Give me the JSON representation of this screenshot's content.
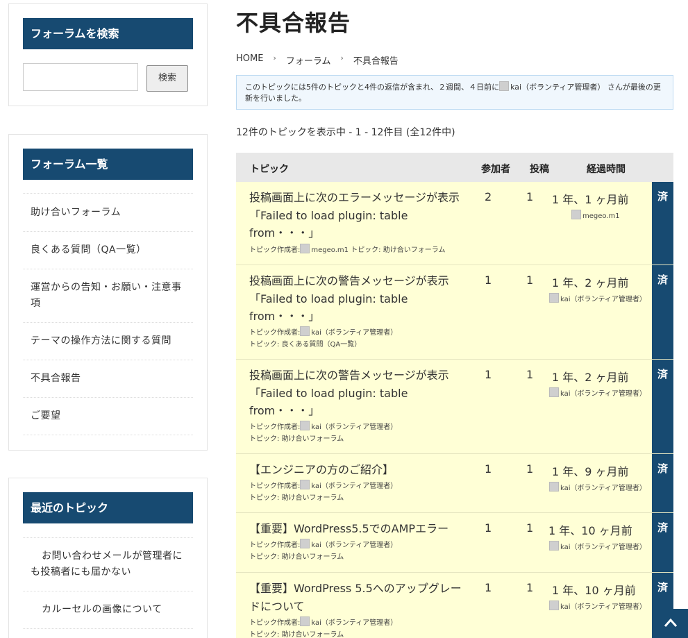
{
  "sidebar": {
    "search": {
      "title": "フォーラムを検索",
      "button": "検索",
      "value": ""
    },
    "forums": {
      "title": "フォーラム一覧",
      "items": [
        {
          "label": "助け合いフォーラム"
        },
        {
          "label": "良くある質問（QA一覧）"
        },
        {
          "label": "運営からの告知・お願い・注意事項"
        },
        {
          "label": "テーマの操作方法に関する質問"
        },
        {
          "label": "不具合報告"
        },
        {
          "label": "ご要望"
        }
      ]
    },
    "recent": {
      "title": "最近のトピック",
      "items": [
        {
          "label": "お問い合わせメールが管理者にも投稿者にも届かない"
        },
        {
          "label": "カルーセルの画像について"
        }
      ]
    }
  },
  "main": {
    "title": "不具合報告",
    "breadcrumb": [
      "HOME",
      "フォーラム",
      "不具合報告"
    ],
    "notice": {
      "before": "このトピックには5件のトピックと4件の返信が含まれ、２週間、４日前に",
      "user": "kai（ボランティア管理者）",
      "after": " さんが最後の更新を行いました。"
    },
    "count": "12件のトピックを表示中 - 1 - 12件目 (全12件中)",
    "columns": {
      "topic": "トピック",
      "voices": "参加者",
      "posts": "投稿",
      "freshness": "経過時間"
    },
    "rows": [
      {
        "title": "投稿画面上に次のエラーメッセージが表示「Failed to load plugin: table from・・・」",
        "meta_author_label": "トピック作成者:",
        "author": "megeo.m1",
        "meta_forum_label": "トピック: ",
        "forum": "助け合いフォーラム",
        "voices": "2",
        "posts": "1",
        "ago": "1 年、1 ヶ月前",
        "last_user": "megeo.m1",
        "status": "済"
      },
      {
        "title": "投稿画面上に次の警告メッセージが表示「Failed to load plugin: table from・・・」",
        "meta_author_label": "トピック作成者:",
        "author": "kai（ボランティア管理者）",
        "meta_forum_label": "トピック: ",
        "forum": "良くある質問（QA一覧）",
        "voices": "1",
        "posts": "1",
        "ago": "1 年、2 ヶ月前",
        "last_user": "kai（ボランティア管理者）",
        "status": "済"
      },
      {
        "title": "投稿画面上に次の警告メッセージが表示「Failed to load plugin: table from・・・」",
        "meta_author_label": "トピック作成者:",
        "author": "kai（ボランティア管理者）",
        "meta_forum_label": "トピック: ",
        "forum": "助け合いフォーラム",
        "voices": "1",
        "posts": "1",
        "ago": "1 年、2 ヶ月前",
        "last_user": "kai（ボランティア管理者）",
        "status": "済"
      },
      {
        "title": "【エンジニアの方のご紹介】",
        "meta_author_label": "トピック作成者:",
        "author": "kai（ボランティア管理者）",
        "meta_forum_label": "トピック: ",
        "forum": "助け合いフォーラム",
        "voices": "1",
        "posts": "1",
        "ago": "1 年、9 ヶ月前",
        "last_user": "kai（ボランティア管理者）",
        "status": "済"
      },
      {
        "title": "【重要】WordPress5.5でのAMPエラー",
        "meta_author_label": "トピック作成者:",
        "author": "kai（ボランティア管理者）",
        "meta_forum_label": "トピック: ",
        "forum": "助け合いフォーラム",
        "voices": "1",
        "posts": "1",
        "ago": "1 年、10 ヶ月前",
        "last_user": "kai（ボランティア管理者）",
        "status": "済"
      },
      {
        "title": "【重要】WordPress 5.5へのアップグレードについて",
        "meta_author_label": "トピック作成者:",
        "author": "kai（ボランティア管理者）",
        "meta_forum_label": "トピック: ",
        "forum": "助け合いフォーラム",
        "voices": "1",
        "posts": "1",
        "ago": "1 年、10 ヶ月前",
        "last_user": "kai（ボランティア管理者）",
        "status": "済"
      }
    ]
  },
  "colors": {
    "accent": "#174a71",
    "row_bg": "#ffffd6",
    "notice_bg": "#f0f7fd"
  },
  "icons": {
    "back_to_top": "chevron-up-icon",
    "avatar": "avatar-icon"
  }
}
